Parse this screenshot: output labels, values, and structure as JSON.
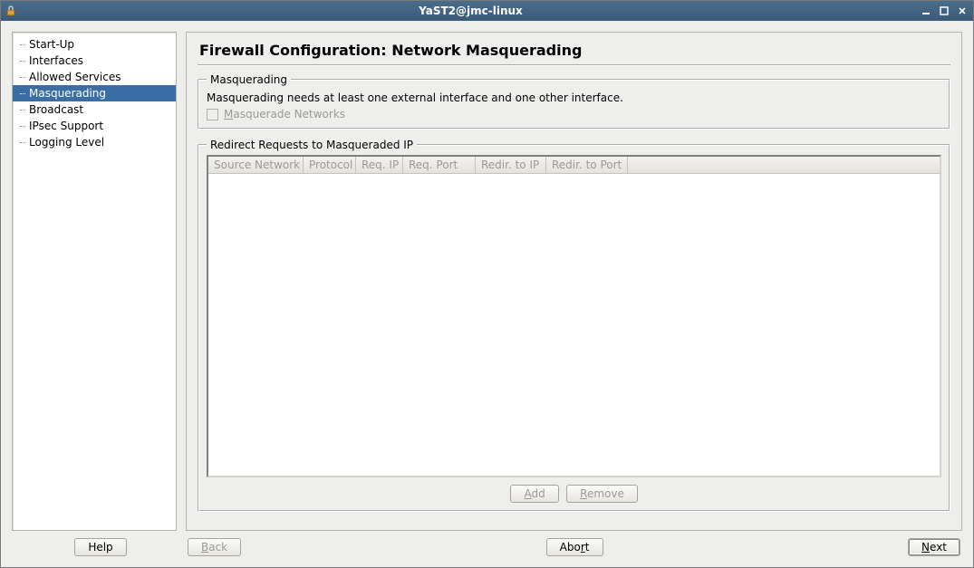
{
  "window": {
    "title": "YaST2@jmc-linux"
  },
  "sidebar": {
    "items": [
      {
        "label": "Start-Up"
      },
      {
        "label": "Interfaces"
      },
      {
        "label": "Allowed Services"
      },
      {
        "label": "Masquerading",
        "selected": true
      },
      {
        "label": "Broadcast"
      },
      {
        "label": "IPsec Support"
      },
      {
        "label": "Logging Level"
      }
    ]
  },
  "page": {
    "title": "Firewall Configuration: Network Masquerading"
  },
  "masq": {
    "legend": "Masquerading",
    "info": "Masquerading needs at least one external interface and one other interface.",
    "checkbox_prefix": "M",
    "checkbox_rest": "asquerade Networks"
  },
  "redirect": {
    "legend": "Redirect Requests to Masqueraded IP",
    "columns": {
      "source": "Source Network",
      "protocol": "Protocol",
      "reqip": "Req. IP",
      "reqport": "Req. Port",
      "redirip": "Redir. to IP",
      "redirport": "Redir. to Port"
    },
    "buttons": {
      "add_prefix": "A",
      "add_rest": "dd",
      "remove_prefix": "R",
      "remove_rest": "emove"
    }
  },
  "footer": {
    "help": "Help",
    "back_prefix": "B",
    "back_rest": "ack",
    "abort_before": "Abo",
    "abort_accel": "r",
    "abort_after": "t",
    "next_prefix": "N",
    "next_rest": "ext"
  }
}
